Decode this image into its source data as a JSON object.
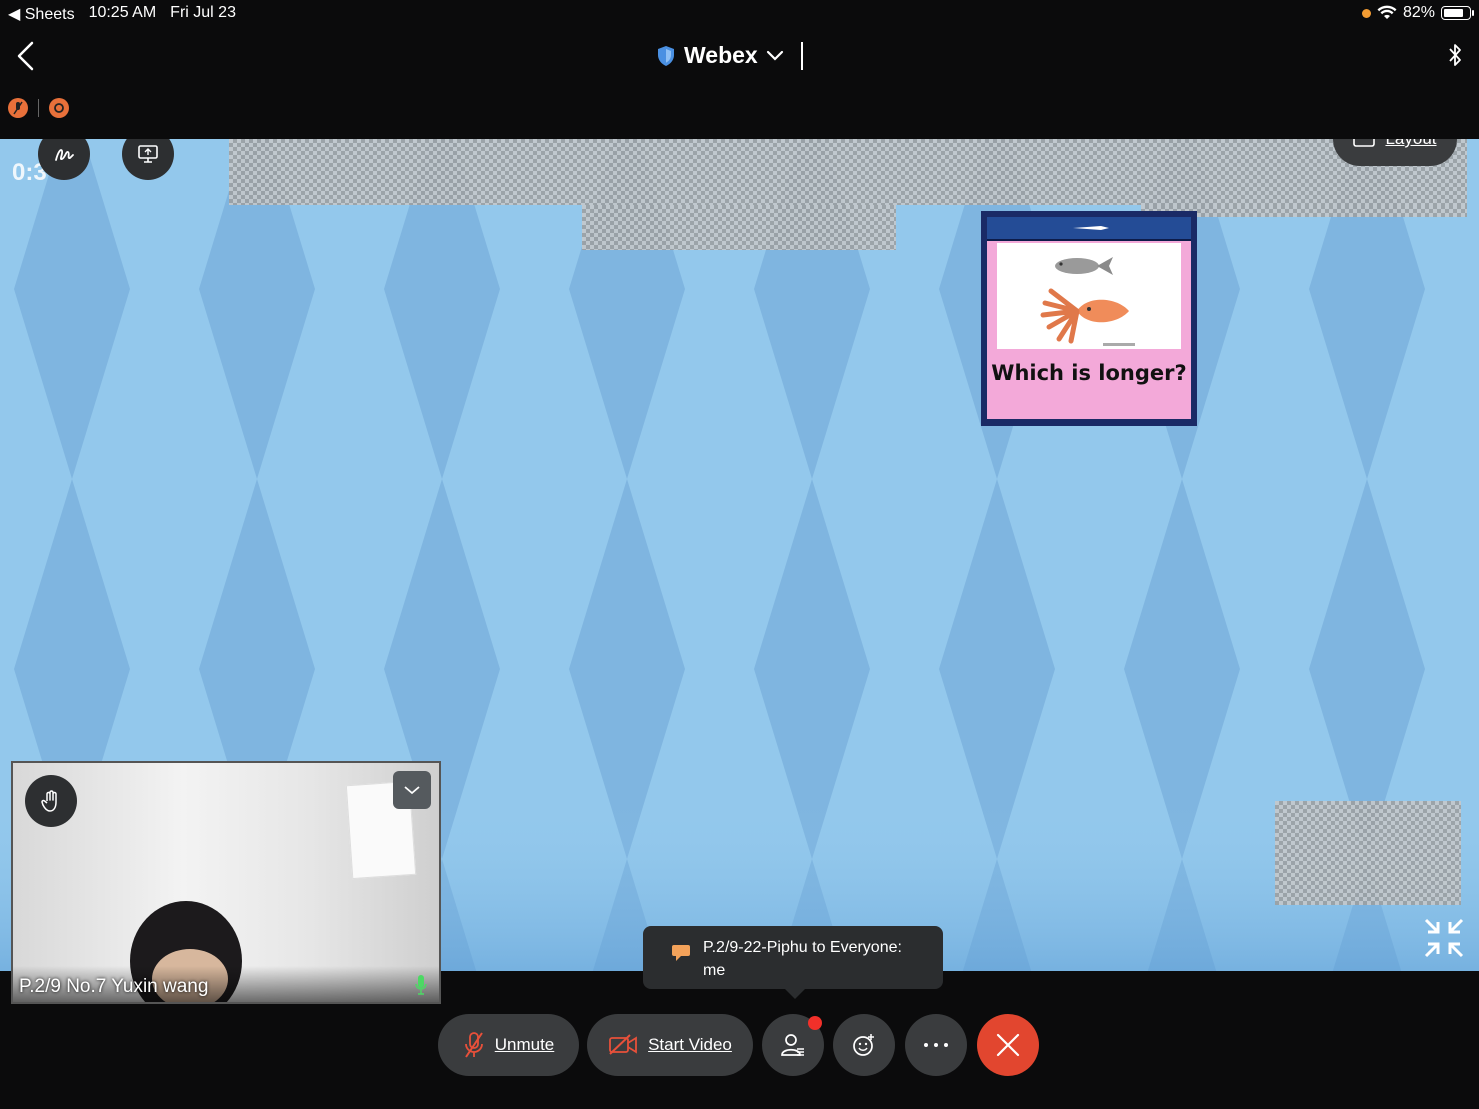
{
  "status_bar": {
    "back_app": "◀ Sheets",
    "time": "10:25 AM",
    "date": "Fri Jul 23",
    "battery": "82%",
    "battery_level": 0.82
  },
  "header": {
    "title": "Webex"
  },
  "share": {
    "timer": "0:3",
    "layout_label": "Layout",
    "slide_question": "Which is longer?"
  },
  "self_view": {
    "name": "P.2/9 No.7 Yuxin wang"
  },
  "chat_toast": {
    "sender": "P.2/9-22-Piphu to Everyone:",
    "message": "me"
  },
  "controls": {
    "unmute_label": "Unmute",
    "start_video_label": "Start Video"
  },
  "colors": {
    "accent_red": "#e2462f",
    "share_blue": "#93c8ec",
    "unmute_icon": "#e8503a",
    "mic_green": "#4cd964"
  }
}
